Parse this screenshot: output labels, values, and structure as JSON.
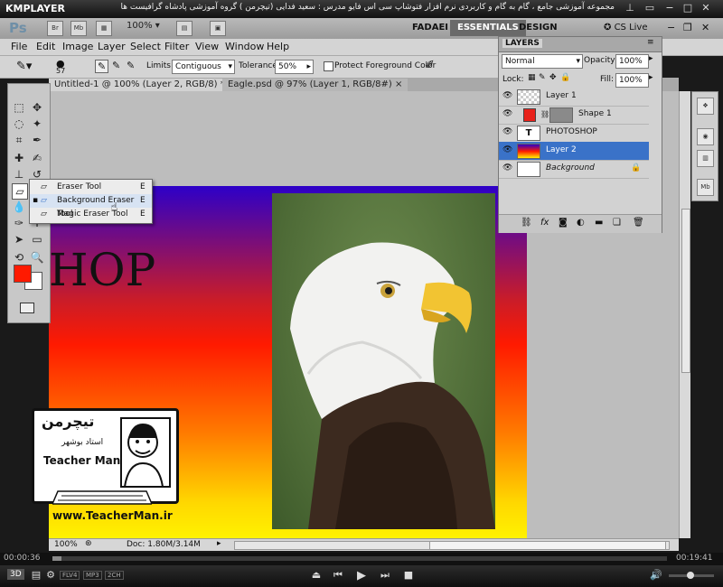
{
  "kmplayer": {
    "logo": "KMPLAYER",
    "caption": "مجموعه آموزشی جامع ، گام به گام و کاربردی نرم افزار فتوشاپ سی اس فایو  مدرس : سعید فدایی (تیچرمن ) گروه آموزشی پادشاه گرافیست ها",
    "time_elapsed": "00:00:36",
    "time_total": "00:19:41",
    "badges": [
      "FLV4",
      "MP3",
      "2CH"
    ],
    "btn_3d": "3D"
  },
  "appbar": {
    "logo": "Ps",
    "br": "Br",
    "mb": "Mb",
    "zoom": "100%",
    "workspace_user": "FADAEI",
    "workspace_active": "ESSENTIALS",
    "workspace_design": "DESIGN",
    "cs_live": "CS Live"
  },
  "menu": [
    "File",
    "Edit",
    "Image",
    "Layer",
    "Select",
    "Filter",
    "View",
    "Window",
    "Help"
  ],
  "options": {
    "brush_size": "57",
    "limits_label": "Limits:",
    "limits_value": "Contiguous",
    "tolerance_label": "Tolerance:",
    "tolerance_value": "50%",
    "protect_label": "Protect Foreground Color"
  },
  "tabs": [
    {
      "label": "Untitled-1 @ 100% (Layer 2, RGB/8) *",
      "active": true
    },
    {
      "label": "Eagle.psd @ 97% (Layer 1, RGB/8#)",
      "active": false
    }
  ],
  "canvas": {
    "text": "HOP"
  },
  "flyout": [
    {
      "label": "Eraser Tool",
      "key": "E"
    },
    {
      "label": "Background Eraser Tool",
      "key": "E"
    },
    {
      "label": "Magic Eraser Tool",
      "key": "E"
    }
  ],
  "layers_panel": {
    "title": "LAYERS",
    "blend_mode": "Normal",
    "opacity_label": "Opacity:",
    "opacity": "100%",
    "lock_label": "Lock:",
    "fill_label": "Fill:",
    "fill": "100%",
    "layers": [
      {
        "name": "Layer 1",
        "selected": false,
        "italic": false
      },
      {
        "name": "Shape 1",
        "selected": false,
        "italic": false
      },
      {
        "name": "PHOTOSHOP",
        "selected": false,
        "italic": false
      },
      {
        "name": "Layer 2",
        "selected": true,
        "italic": false
      },
      {
        "name": "Background",
        "selected": false,
        "italic": true
      }
    ]
  },
  "status": {
    "zoom": "100%",
    "doc": "Doc: 1.80M/3.14M"
  },
  "watermark": {
    "title_fa": "تیچرمن",
    "subtitle_fa": "استاد بوشهر",
    "name_en": "Teacher Man",
    "url": "www.TeacherMan.ir"
  },
  "colors": {
    "foreground": "#ff1a00",
    "background": "#ffffff",
    "selection": "#3a72c8"
  }
}
